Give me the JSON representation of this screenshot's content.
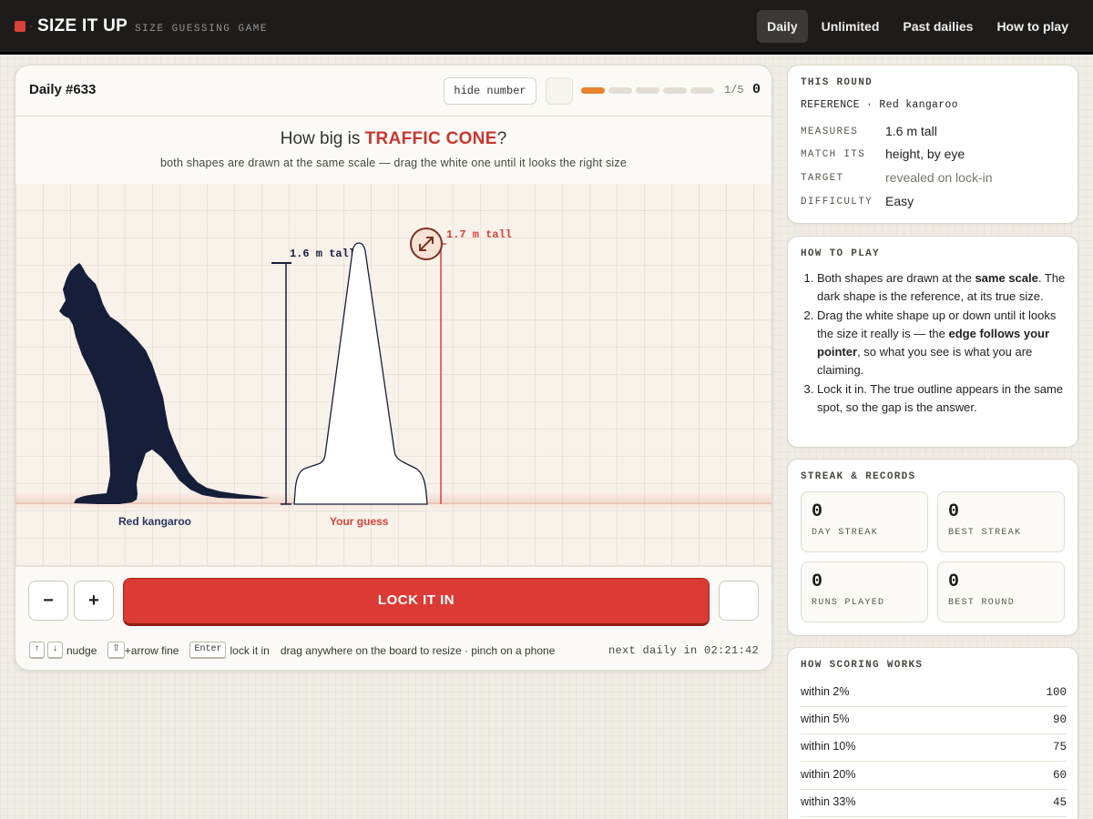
{
  "app": {
    "title": "SIZE IT UP",
    "subtitle": "SIZE GUESSING GAME",
    "separator": "·"
  },
  "nav": {
    "tabs": [
      {
        "label": "Daily",
        "active": true
      },
      {
        "label": "Unlimited",
        "active": false
      },
      {
        "label": "Past dailies",
        "active": false
      },
      {
        "label": "How to play",
        "active": false
      }
    ]
  },
  "game": {
    "title": "Daily #633",
    "hide_numbers_label": "hide number",
    "progress": {
      "current": 1,
      "total": 5,
      "text": "1/5"
    },
    "score": "0",
    "question_prefix": "How big is ",
    "question_target": "TRAFFIC CONE",
    "question_suffix": "?",
    "instructions": "both shapes are drawn at the same scale — drag the white one until it looks the right size",
    "reference_label": "Red kangaroo",
    "reference_measure": "1.6 m tall",
    "guess_label": "Your guess",
    "guess_measure": "1.7 m tall",
    "minus_label": "−",
    "plus_label": "+",
    "lock_label": "LOCK IT IN",
    "next_daily": "next daily in 02:21:42",
    "colors": {
      "accent": "#db3b34",
      "reference": "#161e3a",
      "progress": "#e9822f"
    }
  },
  "hints": {
    "nudge_up_key": "↑",
    "nudge_down_key": "↓",
    "nudge_text": "nudge",
    "shift_key": "⇧",
    "fine_text": "+arrow fine",
    "enter_key": "Enter",
    "lock_text": "lock it in",
    "drag_text": "drag anywhere on the board to resize · pinch on a phone"
  },
  "round": {
    "title": "THIS ROUND",
    "reference_line": "REFERENCE · Red kangaroo",
    "rows": [
      {
        "label": "MEASURES",
        "value": "1.6 m tall"
      },
      {
        "label": "MATCH ITS",
        "value": "height, by eye"
      },
      {
        "label": "TARGET",
        "value": "revealed on lock-in"
      },
      {
        "label": "DIFFICULTY",
        "value": "Easy"
      }
    ]
  },
  "howto": {
    "title": "HOW TO PLAY",
    "steps": [
      {
        "a": "Both shapes are drawn at the ",
        "b": "same scale",
        "c": ". The dark shape is the reference, at its true size."
      },
      {
        "a": "Drag the white shape up or down until it looks the size it really is — the ",
        "b": "edge follows your pointer",
        "c": ", so what you see is what you are claiming."
      },
      {
        "a": "Lock it in. The true outline appears in the same spot, so the gap is the answer.",
        "b": "",
        "c": ""
      }
    ]
  },
  "streak": {
    "title": "STREAK & RECORDS",
    "stats": [
      {
        "value": "0",
        "label": "DAY STREAK"
      },
      {
        "value": "0",
        "label": "BEST STREAK"
      },
      {
        "value": "0",
        "label": "RUNS PLAYED"
      },
      {
        "value": "0",
        "label": "BEST ROUND"
      }
    ]
  },
  "scoring": {
    "title": "HOW SCORING WORKS",
    "rows": [
      {
        "label": "within 2%",
        "points": "100"
      },
      {
        "label": "within 5%",
        "points": "90"
      },
      {
        "label": "within 10%",
        "points": "75"
      },
      {
        "label": "within 20%",
        "points": "60"
      },
      {
        "label": "within 33%",
        "points": "45"
      }
    ]
  }
}
